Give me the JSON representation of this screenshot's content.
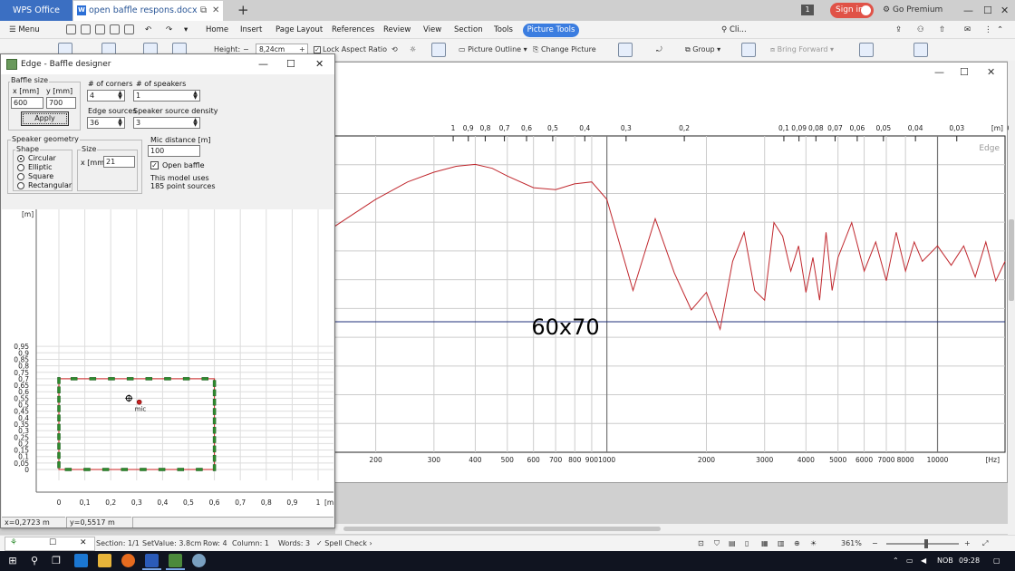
{
  "tabbar": {
    "app_name": "WPS Office",
    "doc_tab": "open baffle respons.docx",
    "new_tab": "+",
    "notif_count": "1",
    "sign_in": "Sign in",
    "go_premium": "Go Premium"
  },
  "ribbon": {
    "menu": "Menu",
    "tabs": [
      "Home",
      "Insert",
      "Page Layout",
      "References",
      "Review",
      "View",
      "Section",
      "Tools"
    ],
    "active_tab": "Picture Tools",
    "search": "Cli..."
  },
  "toolbar": {
    "height_label": "Height:",
    "height_value": "8,24cm",
    "lock_aspect": "Lock Aspect Ratio",
    "picture_outline": "Picture Outline",
    "change_picture": "Change Picture",
    "group": "Group",
    "bring_forward": "Bring Forward"
  },
  "dialog": {
    "title": "Edge - Baffle designer",
    "baffle_size_label": "Baffle size",
    "x_label": "x [mm]",
    "y_label": "y [mm]",
    "x_value": "600",
    "y_value": "700",
    "apply": "Apply",
    "corners_label": "# of corners",
    "corners_value": "4",
    "speakers_label": "# of speakers",
    "speakers_value": "1",
    "edge_sources_label": "Edge sources",
    "edge_sources_value": "36",
    "density_label": "Speaker source density",
    "density_value": "3",
    "speaker_geometry_label": "Speaker geometry",
    "shape_label": "Shape",
    "shapes": [
      "Circular",
      "Elliptic",
      "Square",
      "Rectangular"
    ],
    "selected_shape": "Circular",
    "size_label": "Size",
    "size_x_label": "x [mm]",
    "size_x_value": "21",
    "mic_distance_label": "Mic distance [m]",
    "mic_distance_value": "100",
    "open_baffle": "Open baffle",
    "model_info_1": "This model uses",
    "model_info_2": "185 point sources",
    "status_x": "x=0,2723 m",
    "status_y": "y=0,5517 m",
    "plot": {
      "unit": "[m]",
      "x_ticks": [
        "0",
        "0,1",
        "0,2",
        "0,3",
        "0,4",
        "0,5",
        "0,6",
        "0,7",
        "0,8",
        "0,9",
        "1"
      ],
      "y_ticks": [
        "0",
        "0,05",
        "0,1",
        "0,15",
        "0,2",
        "0,25",
        "0,3",
        "0,35",
        "0,4",
        "0,45",
        "0,5",
        "0,55",
        "0,6",
        "0,65",
        "0,7",
        "0,75",
        "0,8",
        "0,85",
        "0,9",
        "0,95"
      ],
      "baffle_width_m": 0.6,
      "baffle_height_m": 0.7,
      "mic_label": "mic",
      "mic_x": 0.31,
      "mic_y": 0.52,
      "speaker_x": 0.27,
      "speaker_y": 0.55
    }
  },
  "graph_window": {
    "watermark": "Edge",
    "overlay_text": "60x70",
    "top_unit": "[m]",
    "top_ticks": [
      "1",
      "0,9",
      "0,8",
      "0,7",
      "0,6",
      "0,5",
      "0,4",
      "0,3",
      "0,2",
      "0,1",
      "0,09",
      "0,08",
      "0,07",
      "0,06",
      "0,05",
      "0,04",
      "0,03",
      "0,02"
    ],
    "bottom_unit": "[Hz]",
    "bottom_ticks": [
      "200",
      "300",
      "400",
      "500",
      "600",
      "700",
      "800",
      "900",
      "1000",
      "2000",
      "3000",
      "4000",
      "5000",
      "6000",
      "7000",
      "8000",
      "10000"
    ]
  },
  "chart_data": {
    "type": "line",
    "xscale": "log",
    "xlabel": "[Hz]",
    "x": [
      150,
      200,
      250,
      300,
      350,
      400,
      450,
      500,
      600,
      700,
      800,
      900,
      1000,
      1200,
      1400,
      1600,
      1800,
      2000,
      2200,
      2400,
      2600,
      2800,
      3000,
      3200,
      3400,
      3600,
      3800,
      4000,
      4200,
      4400,
      4600,
      4800,
      5000,
      5500,
      6000,
      6500,
      7000,
      7500,
      8000,
      8500,
      9000,
      10000,
      11000,
      12000,
      13000,
      14000,
      15000,
      16000
    ],
    "series": [
      {
        "values": [
          3.8,
          5.2,
          6.1,
          6.6,
          6.9,
          7.0,
          6.8,
          6.4,
          5.8,
          5.7,
          6.0,
          6.1,
          5.2,
          0.5,
          4.2,
          1.4,
          -0.5,
          0.4,
          -1.5,
          2.0,
          3.5,
          0.5,
          0.0,
          4.0,
          3.3,
          1.5,
          2.8,
          0.4,
          2.2,
          0.0,
          3.5,
          0.5,
          2.2,
          4.0,
          1.5,
          3.0,
          1.0,
          3.5,
          1.5,
          3.0,
          2.0,
          2.8,
          1.8,
          2.8,
          1.2,
          3.0,
          1.0,
          2.0
        ]
      }
    ],
    "overlay_label": "60x70",
    "grid": true
  },
  "statusbar": {
    "section": "Section: 1/1",
    "set_value": "SetValue: 3.8cm",
    "row": "Row: 4",
    "column": "Column: 1",
    "words": "Words: 3",
    "spell_check": "Spell Check",
    "zoom": "361%"
  },
  "taskbar": {
    "lang": "NOB",
    "time": "09:28"
  },
  "colors": {
    "wps_blue": "#3b6fc2",
    "accent_tab": "#3b7de0",
    "sign_in": "#e05247",
    "curve": "#c0282e",
    "baffle_edge": "#cc2222",
    "edge_source": "#2e8b2e",
    "hline": "#1f2f7a"
  }
}
